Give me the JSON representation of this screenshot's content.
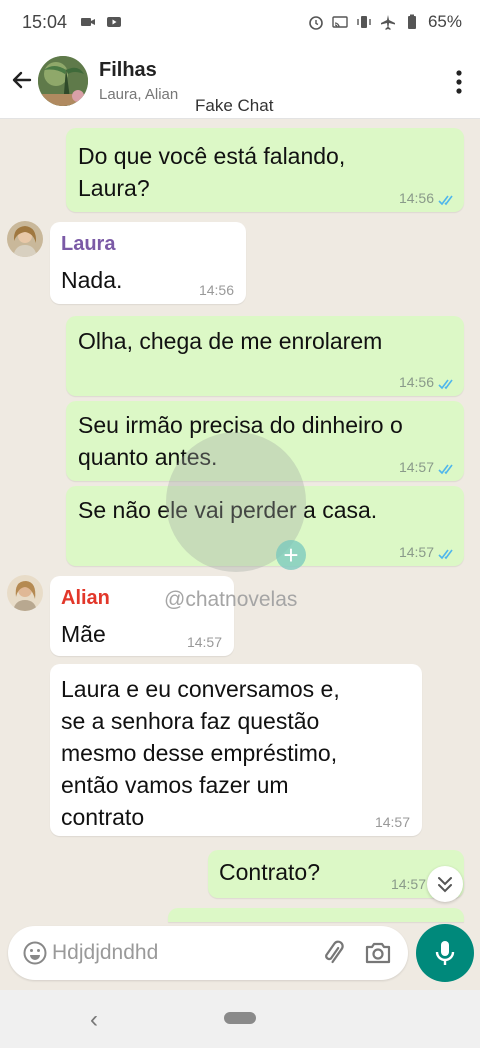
{
  "status_bar": {
    "time": "15:04",
    "battery": "65%"
  },
  "header": {
    "title": "Filhas",
    "subtitle": "Laura, Alian",
    "app_label": "Fake Chat"
  },
  "messages": [
    {
      "type": "out",
      "text": "Do que você está falando,\nLaura?",
      "time": "14:56"
    },
    {
      "type": "in",
      "sender": "Laura",
      "sender_color": "#7b5aa6",
      "text": "Nada.",
      "time": "14:56"
    },
    {
      "type": "out",
      "text": "Olha, chega de me enrolarem",
      "time": "14:56"
    },
    {
      "type": "out",
      "text": "Seu irmão precisa do dinheiro o\nquanto antes.",
      "time": "14:57"
    },
    {
      "type": "out",
      "text": "Se não ele vai perder a casa.",
      "time": "14:57"
    },
    {
      "type": "in",
      "sender": "Alian",
      "sender_color": "#e2372a",
      "text": "Mãe",
      "time": "14:57"
    },
    {
      "type": "in",
      "text": "Laura e eu conversamos e,\nse a senhora faz questão\nmesmo desse empréstimo,\nentão vamos fazer um\ncontrato",
      "time": "14:57"
    },
    {
      "type": "out",
      "text": "Contrato?",
      "time": "14:57"
    }
  ],
  "watermark": "@chatnovelas",
  "composer": {
    "placeholder": "Hdjdjdndhd"
  },
  "colors": {
    "outgoing": "#dcf8c6",
    "incoming": "#ffffff",
    "background": "#efeae2",
    "accent": "#00897b",
    "read_ticks": "#4fb6ec"
  },
  "icons": [
    "back-arrow-icon",
    "menu-dots-icon",
    "emoji-icon",
    "attach-icon",
    "camera-icon",
    "mic-icon",
    "scroll-down-icon",
    "nav-back-icon",
    "nav-home-icon"
  ]
}
